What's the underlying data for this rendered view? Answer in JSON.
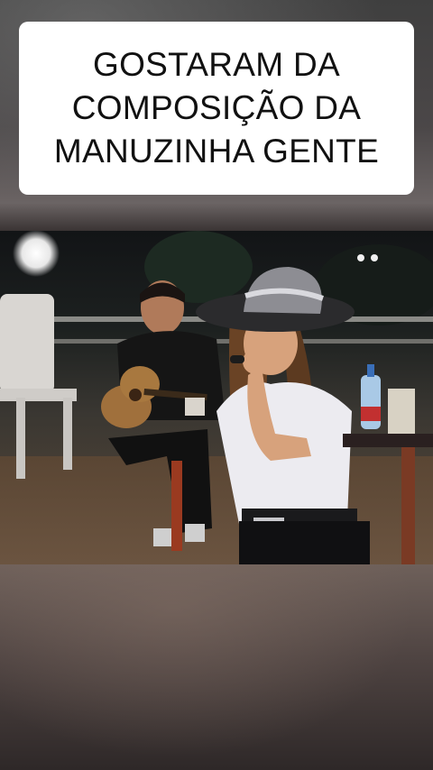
{
  "caption": {
    "lines": [
      "GOSTARAM DA",
      "COMPOSIÇÃO DA",
      "MANUZINHA GENTE"
    ]
  },
  "video": {
    "scene": "musician-performance"
  },
  "colors": {
    "caption_bg": "#ffffff",
    "caption_text": "#111111",
    "background": "#2a2626"
  }
}
